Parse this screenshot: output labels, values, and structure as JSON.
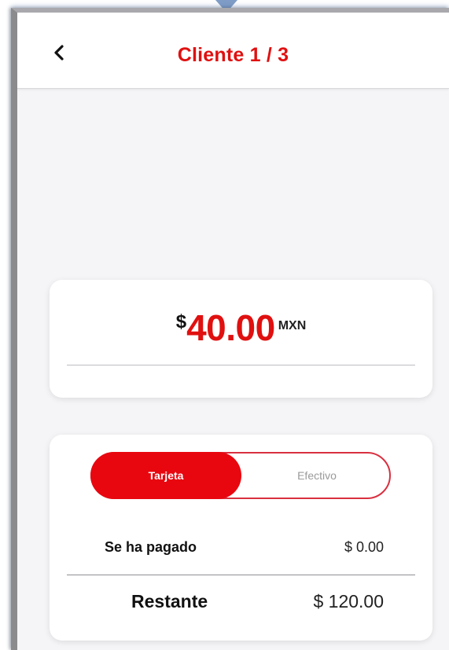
{
  "header": {
    "title": "Cliente 1 / 3",
    "back_icon": "chevron-left-icon"
  },
  "amount_card": {
    "currency_symbol": "$",
    "amount": "40.00",
    "currency_code": "MXN"
  },
  "payment_card": {
    "method_options": [
      {
        "label": "Tarjeta",
        "selected": true
      },
      {
        "label": "Efectivo",
        "selected": false
      }
    ],
    "paid_label": "Se ha pagado",
    "paid_value": "$ 0.00",
    "remaining_label": "Restante",
    "remaining_value": "$ 120.00"
  },
  "colors": {
    "accent": "#e8070f",
    "title": "#e01010",
    "background": "#f5f5f7"
  }
}
